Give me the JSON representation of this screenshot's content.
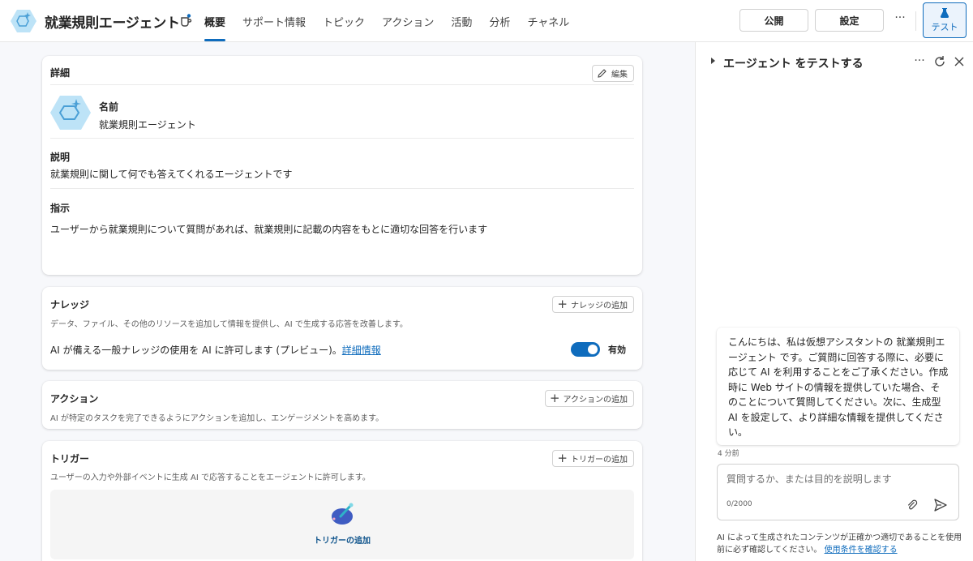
{
  "header": {
    "agent_name": "就業規則エージェント",
    "tabs": [
      {
        "label": "概要",
        "active": true
      },
      {
        "label": "サポート情報",
        "active": false
      },
      {
        "label": "トピック",
        "active": false
      },
      {
        "label": "アクション",
        "active": false
      },
      {
        "label": "活動",
        "active": false
      },
      {
        "label": "分析",
        "active": false
      },
      {
        "label": "チャネル",
        "active": false
      }
    ],
    "publish_label": "公開",
    "settings_label": "設定",
    "more_label": "···",
    "test_label": "テスト",
    "accent_color": "#0f6cbd"
  },
  "details": {
    "title": "詳細",
    "edit_label": "編集",
    "name_label": "名前",
    "name_value": "就業規則エージェント",
    "description_label": "説明",
    "description_value": "就業規則に関して何でも答えてくれるエージェントです",
    "instructions_label": "指示",
    "instructions_value": "ユーザーから就業規則について質問があれば、就業規則に記載の内容をもとに適切な回答を行います"
  },
  "knowledge": {
    "title": "ナレッジ",
    "add_label": "ナレッジの追加",
    "description": "データ、ファイル、その他のリソースを追加して情報を提供し、AI で生成する応答を改善します。",
    "general_knowledge_text": "AI が備える一般ナレッジの使用を AI に許可します (プレビュー)。",
    "learn_more": "詳細情報",
    "toggle_on": true,
    "toggle_label": "有効"
  },
  "actions": {
    "title": "アクション",
    "add_label": "アクションの追加",
    "description": "AI が特定のタスクを完了できるようにアクションを追加し、エンゲージメントを高めます。"
  },
  "triggers": {
    "title": "トリガー",
    "add_label": "トリガーの追加",
    "description": "ユーザーの入力や外部イベントに生成 AI で応答することをエージェントに許可します。",
    "empty_add_label": "トリガーの追加"
  },
  "test_pane": {
    "title": "エージェント をテストする",
    "more_label": "···",
    "message": "こんにちは、私は仮想アシスタントの 就業規則エージェント です。ご質問に回答する際に、必要に応じて AI を利用することをご了承ください。作成時に Web サイトの情報を提供していた場合、そのことについて質問してください。次に、生成型 AI を設定して、より詳細な情報を提供してください。",
    "timestamp": "4 分前",
    "input_placeholder": "質問するか、または目的を説明します",
    "counter": "0/2000",
    "disclaimer": "AI によって生成されたコンテンツが正確かつ適切であることを使用前に必ず確認してください。",
    "terms_link": "使用条件を確認する"
  }
}
